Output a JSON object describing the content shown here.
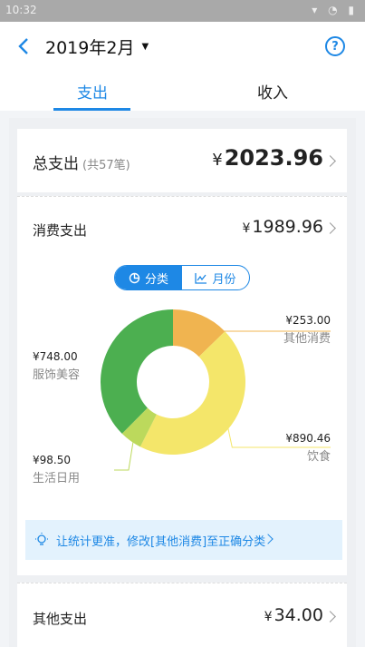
{
  "status_bar": {
    "time": "10:32"
  },
  "header": {
    "title": "2019年2月",
    "tabs": [
      {
        "label": "支出"
      },
      {
        "label": "收入"
      }
    ]
  },
  "total": {
    "label": "总支出",
    "count": "(共57笔)",
    "currency": "¥",
    "amount": "2023.96"
  },
  "consume": {
    "label": "消费支出",
    "currency": "¥",
    "amount": "1989.96",
    "toggle": [
      {
        "label": "分类"
      },
      {
        "label": "月份"
      }
    ]
  },
  "chart_data": {
    "type": "pie",
    "title": "",
    "slices": [
      {
        "name": "其他消费",
        "value_label": "¥253.00",
        "value": 253.0,
        "color": "#f0b450"
      },
      {
        "name": "饮食",
        "value_label": "¥890.46",
        "value": 890.46,
        "color": "#f4e66a"
      },
      {
        "name": "生活日用",
        "value_label": "¥98.50",
        "value": 98.5,
        "color": "#bcd95c"
      },
      {
        "name": "服饰美容",
        "value_label": "¥748.00",
        "value": 748.0,
        "color": "#4caf50"
      }
    ]
  },
  "tip": {
    "text": "让统计更准，修改[其他消费]至正确分类"
  },
  "other": {
    "label": "其他支出",
    "currency": "¥",
    "amount": "34.00"
  },
  "colors": {
    "accent": "#1e88e5"
  }
}
